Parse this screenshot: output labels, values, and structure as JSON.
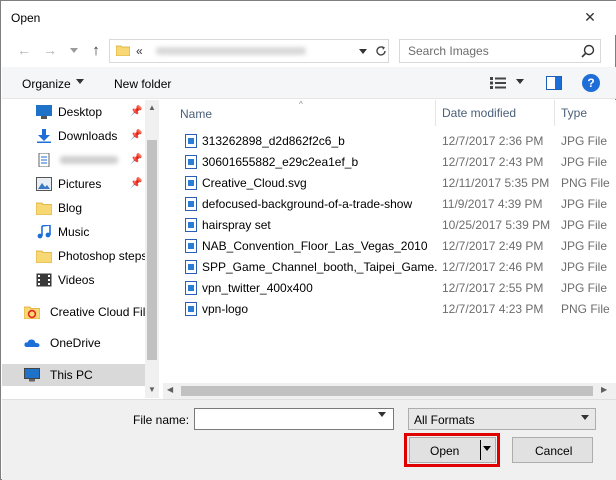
{
  "window": {
    "title": "Open",
    "close_glyph": "✕"
  },
  "nav_buttons": {
    "back_glyph": "←",
    "forward_glyph": "→",
    "dropdown_glyph": "⌄",
    "up_glyph": "↑"
  },
  "address": {
    "prefix": "«",
    "path_obscured": true
  },
  "search": {
    "placeholder": "Search Images"
  },
  "command_bar": {
    "organize_label": "Organize",
    "new_folder_label": "New folder",
    "help_glyph": "?"
  },
  "nav_pane": {
    "items": [
      {
        "label": "Desktop",
        "icon": "desktop-icon",
        "pinned": true
      },
      {
        "label": "Downloads",
        "icon": "download-icon",
        "pinned": true
      },
      {
        "label": "",
        "icon": "document-icon",
        "pinned": true,
        "obscured": true
      },
      {
        "label": "Pictures",
        "icon": "pictures-icon",
        "pinned": true
      },
      {
        "label": "Blog",
        "icon": "folder-icon",
        "pinned": false
      },
      {
        "label": "Music",
        "icon": "music-icon",
        "pinned": false
      },
      {
        "label": "Photoshop steps",
        "icon": "folder-icon",
        "pinned": false
      },
      {
        "label": "Videos",
        "icon": "videos-icon",
        "pinned": false
      },
      {
        "label": "Creative Cloud Fil",
        "icon": "creative-cloud-folder-icon",
        "pinned": false
      },
      {
        "label": "OneDrive",
        "icon": "onedrive-icon",
        "pinned": false
      },
      {
        "label": "This PC",
        "icon": "computer-icon",
        "pinned": false,
        "selected": true
      }
    ],
    "pin_glyph": "📌"
  },
  "file_list": {
    "columns": {
      "name": "Name",
      "date": "Date modified",
      "type": "Type"
    },
    "sort_glyph": "^",
    "rows": [
      {
        "name": "313262898_d2d862f2c6_b",
        "date": "12/7/2017 2:36 PM",
        "type": "JPG File"
      },
      {
        "name": "30601655882_e29c2ea1ef_b",
        "date": "12/7/2017 2:43 PM",
        "type": "JPG File"
      },
      {
        "name": "Creative_Cloud.svg",
        "date": "12/11/2017 5:35 PM",
        "type": "PNG File"
      },
      {
        "name": "defocused-background-of-a-trade-show",
        "date": "11/9/2017 4:39 PM",
        "type": "JPG File"
      },
      {
        "name": "hairspray set",
        "date": "10/25/2017 5:39 PM",
        "type": "JPG File"
      },
      {
        "name": "NAB_Convention_Floor_Las_Vegas_2010",
        "date": "12/7/2017 2:49 PM",
        "type": "JPG File"
      },
      {
        "name": "SPP_Game_Channel_booth,_Taipei_Game...",
        "date": "12/7/2017 2:46 PM",
        "type": "JPG File"
      },
      {
        "name": "vpn_twitter_400x400",
        "date": "12/7/2017 2:55 PM",
        "type": "JPG File"
      },
      {
        "name": "vpn-logo",
        "date": "12/7/2017 4:23 PM",
        "type": "PNG File"
      }
    ]
  },
  "bottom": {
    "file_name_label": "File name:",
    "file_name_value": "",
    "format_value": "All Formats",
    "open_label": "Open",
    "cancel_label": "Cancel"
  },
  "colors": {
    "accent": "#1e6ed8",
    "highlight_border": "#e00000",
    "selected_bg": "#d9d9d9"
  }
}
